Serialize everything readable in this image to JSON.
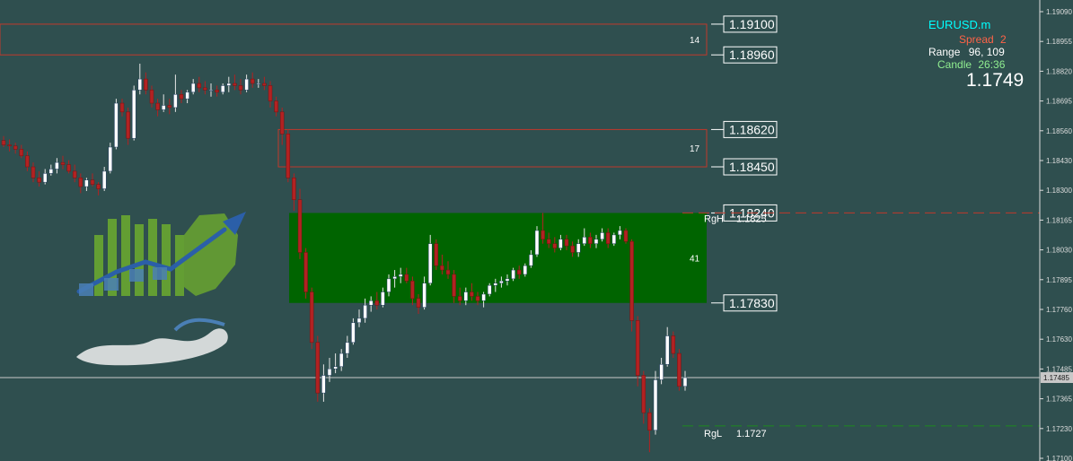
{
  "chart_data": {
    "type": "candlestick",
    "symbol": "EURUSD.m",
    "info": {
      "spread_label": "Spread",
      "spread": "2",
      "range_label": "Range",
      "range": "96, 109",
      "candle_label": "Candle",
      "candle_time": "26:36",
      "bid": "1.1749"
    },
    "ylim": [
      1.1711,
      1.1921
    ],
    "y_ticks": [
      "1.19090",
      "1.18955",
      "1.18820",
      "1.18695",
      "1.18560",
      "1.18430",
      "1.18300",
      "1.18165",
      "1.18030",
      "1.17895",
      "1.17760",
      "1.17630",
      "1.17485",
      "1.17365",
      "1.17230",
      "1.17100"
    ],
    "current_price": 1.1749,
    "current_price_label": "1.17485",
    "zones": [
      {
        "top": 1.191,
        "bottom": 1.1896,
        "label": "14",
        "top_label": "1.19100",
        "bottom_label": "1.18960",
        "fill": "none",
        "stroke": "#c0392b"
      },
      {
        "top": 1.1862,
        "bottom": 1.1845,
        "label": "17",
        "top_label": "1.18620",
        "bottom_label": "1.18450",
        "fill": "none",
        "stroke": "#c0392b"
      },
      {
        "top": 1.1824,
        "bottom": 1.1783,
        "label": "41",
        "top_label": "1.18240",
        "bottom_label": "1.17830",
        "fill": "#006400",
        "stroke": "none"
      }
    ],
    "range_lines": [
      {
        "name": "RgH",
        "value": "1.1825",
        "price": 1.1824,
        "color": "#c0392b"
      },
      {
        "name": "RgL",
        "value": "1.1727",
        "price": 1.1727,
        "color": "#1e8b1e"
      }
    ],
    "candles": [
      [
        1.1857,
        1.1859,
        1.1854,
        1.1855
      ],
      [
        1.1855,
        1.18575,
        1.1852,
        1.18545
      ],
      [
        1.18545,
        1.1856,
        1.1851,
        1.1853
      ],
      [
        1.1853,
        1.1855,
        1.1849,
        1.185
      ],
      [
        1.185,
        1.1852,
        1.1843,
        1.1845
      ],
      [
        1.1845,
        1.1847,
        1.1838,
        1.184
      ],
      [
        1.184,
        1.1843,
        1.1836,
        1.1838
      ],
      [
        1.1838,
        1.1844,
        1.1837,
        1.1842
      ],
      [
        1.1842,
        1.1846,
        1.1841,
        1.1844
      ],
      [
        1.1844,
        1.1849,
        1.1842,
        1.1847
      ],
      [
        1.1847,
        1.185,
        1.1844,
        1.1846
      ],
      [
        1.1846,
        1.1848,
        1.1842,
        1.1843
      ],
      [
        1.1843,
        1.1846,
        1.1838,
        1.184
      ],
      [
        1.184,
        1.1842,
        1.1833,
        1.1836
      ],
      [
        1.1836,
        1.184,
        1.1834,
        1.1839
      ],
      [
        1.1839,
        1.1842,
        1.1836,
        1.1837
      ],
      [
        1.1837,
        1.1838,
        1.1832,
        1.1835
      ],
      [
        1.1835,
        1.1845,
        1.1834,
        1.1843
      ],
      [
        1.1843,
        1.1856,
        1.1842,
        1.1854
      ],
      [
        1.1854,
        1.1876,
        1.1853,
        1.1874
      ],
      [
        1.1874,
        1.1876,
        1.1868,
        1.187
      ],
      [
        1.187,
        1.1872,
        1.1855,
        1.1858
      ],
      [
        1.1858,
        1.1882,
        1.1857,
        1.188
      ],
      [
        1.188,
        1.1892,
        1.1878,
        1.1885
      ],
      [
        1.1885,
        1.1888,
        1.1878,
        1.188
      ],
      [
        1.188,
        1.1882,
        1.1872,
        1.1874
      ],
      [
        1.1874,
        1.1876,
        1.1868,
        1.1871
      ],
      [
        1.1871,
        1.1878,
        1.187,
        1.1873
      ],
      [
        1.1873,
        1.1876,
        1.1869,
        1.1872
      ],
      [
        1.1872,
        1.1887,
        1.187,
        1.1878
      ],
      [
        1.1878,
        1.188,
        1.1874,
        1.1876
      ],
      [
        1.1876,
        1.188,
        1.1874,
        1.1879
      ],
      [
        1.1879,
        1.1885,
        1.1878,
        1.1883
      ],
      [
        1.1883,
        1.1886,
        1.1879,
        1.1881
      ],
      [
        1.1881,
        1.1884,
        1.1878,
        1.188
      ],
      [
        1.188,
        1.1883,
        1.1877,
        1.188
      ],
      [
        1.188,
        1.1882,
        1.1877,
        1.1879
      ],
      [
        1.1879,
        1.1883,
        1.1878,
        1.1882
      ],
      [
        1.1882,
        1.1886,
        1.1879,
        1.1883
      ],
      [
        1.1883,
        1.1887,
        1.188,
        1.1882
      ],
      [
        1.1882,
        1.1885,
        1.1878,
        1.188
      ],
      [
        1.188,
        1.1887,
        1.1879,
        1.1885
      ],
      [
        1.1885,
        1.1888,
        1.1881,
        1.1883
      ],
      [
        1.1883,
        1.1885,
        1.1881,
        1.1883
      ],
      [
        1.1883,
        1.1886,
        1.188,
        1.1882
      ],
      [
        1.1882,
        1.1884,
        1.1872,
        1.1875
      ],
      [
        1.1875,
        1.1877,
        1.1868,
        1.187
      ],
      [
        1.187,
        1.1872,
        1.1855,
        1.186
      ],
      [
        1.186,
        1.1862,
        1.1838,
        1.184
      ],
      [
        1.184,
        1.1842,
        1.1825,
        1.183
      ],
      [
        1.183,
        1.1835,
        1.1803,
        1.1806
      ],
      [
        1.1806,
        1.1808,
        1.1785,
        1.1788
      ],
      [
        1.1788,
        1.179,
        1.1762,
        1.1765
      ],
      [
        1.1765,
        1.1768,
        1.1738,
        1.1742
      ],
      [
        1.1742,
        1.1755,
        1.1738,
        1.175
      ],
      [
        1.175,
        1.1758,
        1.1747,
        1.1753
      ],
      [
        1.1753,
        1.176,
        1.1751,
        1.1754
      ],
      [
        1.1754,
        1.1762,
        1.1752,
        1.176
      ],
      [
        1.176,
        1.1768,
        1.1758,
        1.1765
      ],
      [
        1.1765,
        1.1776,
        1.1764,
        1.1774
      ],
      [
        1.1774,
        1.178,
        1.1772,
        1.1776
      ],
      [
        1.1776,
        1.1785,
        1.1774,
        1.1782
      ],
      [
        1.1782,
        1.1786,
        1.1779,
        1.1784
      ],
      [
        1.1784,
        1.1788,
        1.178,
        1.1782
      ],
      [
        1.1782,
        1.179,
        1.1781,
        1.1788
      ],
      [
        1.1788,
        1.1796,
        1.1786,
        1.1794
      ],
      [
        1.1794,
        1.1798,
        1.179,
        1.1795
      ],
      [
        1.1795,
        1.1799,
        1.1792,
        1.1796
      ],
      [
        1.1796,
        1.1799,
        1.1792,
        1.1793
      ],
      [
        1.1793,
        1.1795,
        1.1782,
        1.1785
      ],
      [
        1.1785,
        1.1787,
        1.1778,
        1.1781
      ],
      [
        1.1781,
        1.1795,
        1.178,
        1.1792
      ],
      [
        1.1792,
        1.1814,
        1.1791,
        1.181
      ],
      [
        1.181,
        1.1812,
        1.1798,
        1.18
      ],
      [
        1.18,
        1.1805,
        1.1796,
        1.1798
      ],
      [
        1.1798,
        1.1802,
        1.1794,
        1.1796
      ],
      [
        1.1796,
        1.1798,
        1.1783,
        1.1786
      ],
      [
        1.1786,
        1.179,
        1.1782,
        1.1784
      ],
      [
        1.1784,
        1.179,
        1.1782,
        1.1788
      ],
      [
        1.1788,
        1.1792,
        1.1784,
        1.1786
      ],
      [
        1.1786,
        1.1788,
        1.1782,
        1.1784
      ],
      [
        1.1784,
        1.1788,
        1.1781,
        1.1787
      ],
      [
        1.1787,
        1.1792,
        1.1786,
        1.1791
      ],
      [
        1.1791,
        1.1794,
        1.1788,
        1.1792
      ],
      [
        1.1792,
        1.1795,
        1.179,
        1.1793
      ],
      [
        1.1793,
        1.1796,
        1.1791,
        1.1794
      ],
      [
        1.1794,
        1.1799,
        1.1793,
        1.1798
      ],
      [
        1.1798,
        1.18,
        1.1794,
        1.1796
      ],
      [
        1.1796,
        1.1801,
        1.1795,
        1.18
      ],
      [
        1.18,
        1.1807,
        1.1799,
        1.1805
      ],
      [
        1.1805,
        1.1818,
        1.1804,
        1.1816
      ],
      [
        1.1816,
        1.1824,
        1.181,
        1.1812
      ],
      [
        1.1812,
        1.1815,
        1.1808,
        1.181
      ],
      [
        1.181,
        1.1813,
        1.1806,
        1.1808
      ],
      [
        1.1808,
        1.1814,
        1.1807,
        1.1812
      ],
      [
        1.1812,
        1.1814,
        1.1807,
        1.1809
      ],
      [
        1.1809,
        1.1811,
        1.1804,
        1.1806
      ],
      [
        1.1806,
        1.1812,
        1.1804,
        1.181
      ],
      [
        1.181,
        1.1817,
        1.1809,
        1.1813
      ],
      [
        1.1813,
        1.1815,
        1.1808,
        1.181
      ],
      [
        1.181,
        1.1814,
        1.1808,
        1.1812
      ],
      [
        1.1812,
        1.1817,
        1.1811,
        1.1815
      ],
      [
        1.1815,
        1.1817,
        1.1808,
        1.181
      ],
      [
        1.181,
        1.1815,
        1.1809,
        1.1814
      ],
      [
        1.1814,
        1.1818,
        1.1812,
        1.1816
      ],
      [
        1.1816,
        1.1817,
        1.181,
        1.1811
      ],
      [
        1.1811,
        1.1812,
        1.177,
        1.1775
      ],
      [
        1.1775,
        1.1777,
        1.1745,
        1.175
      ],
      [
        1.175,
        1.1752,
        1.1728,
        1.1733
      ],
      [
        1.1733,
        1.1735,
        1.1715,
        1.1725
      ],
      [
        1.1725,
        1.1752,
        1.1723,
        1.1748
      ],
      [
        1.1748,
        1.1758,
        1.1746,
        1.1755
      ],
      [
        1.1755,
        1.1772,
        1.1754,
        1.1768
      ],
      [
        1.1768,
        1.177,
        1.1758,
        1.176
      ],
      [
        1.176,
        1.1762,
        1.1743,
        1.1745
      ],
      [
        1.1745,
        1.1752,
        1.1743,
        1.1749
      ]
    ]
  }
}
